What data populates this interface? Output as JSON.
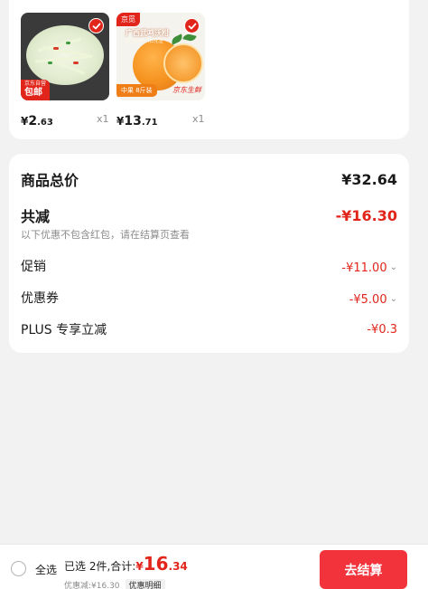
{
  "products": [
    {
      "tag_small": "京东自营",
      "tag_big": "包邮",
      "price_currency": "¥",
      "price_int": "2",
      "price_dec": ".63",
      "qty": "x1"
    },
    {
      "brand_tag": "京觅",
      "banner_text": "广西武鸣沃柑",
      "banner_sub": "多汁饱满 入口化渣",
      "weight_badge": "中果 8斤装",
      "script_badge": "京东生鲜",
      "price_currency": "¥",
      "price_int": "13",
      "price_dec": ".71",
      "qty": "x1"
    }
  ],
  "summary": {
    "goods_total_label": "商品总价",
    "goods_total_value": "¥32.64",
    "total_reduction_label": "共减",
    "total_reduction_value": "-¥16.30",
    "note": "以下优惠不包含红包，请在结算页查看",
    "promo_label": "促销",
    "promo_value": "-¥11.00",
    "coupon_label": "优惠券",
    "coupon_value": "-¥5.00",
    "plus_label": "PLUS 专享立减",
    "plus_value": "-¥0.3"
  },
  "bottom_bar": {
    "select_all_label": "全选",
    "selected_text": "已选 2件,合计:",
    "total_currency": "¥",
    "total_int": "16",
    "total_dec": ".34",
    "discount_text": "优惠减:¥16.30",
    "detail_label": "优惠明细",
    "checkout_label": "去结算"
  },
  "colors": {
    "accent_red": "#e1251b",
    "checkout_red": "#f2333c",
    "page_bg": "#f2f2f2"
  }
}
